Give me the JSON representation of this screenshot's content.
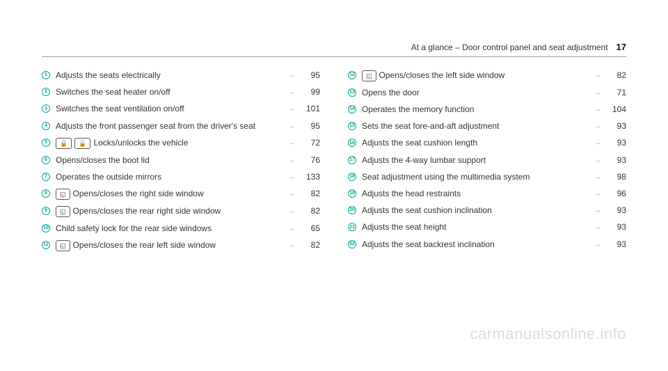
{
  "header": {
    "title": "At a glance – Door control panel and seat adjustment",
    "page": "17"
  },
  "left": [
    {
      "n": "1",
      "icons": [],
      "text": "Adjusts the seats electrically",
      "page": "95"
    },
    {
      "n": "2",
      "icons": [],
      "text": "Switches the seat heater on/off",
      "page": "99"
    },
    {
      "n": "3",
      "icons": [],
      "text": "Switches the seat ventilation on/off",
      "page": "101"
    },
    {
      "n": "4",
      "icons": [],
      "text": "Adjusts the front passenger seat from the driv­er's seat",
      "page": "95"
    },
    {
      "n": "5",
      "icons": [
        "🔒",
        "🔓"
      ],
      "text": "Locks/unlocks the vehicle",
      "page": "72"
    },
    {
      "n": "6",
      "icons": [],
      "text": "Opens/closes the boot lid",
      "page": "76"
    },
    {
      "n": "7",
      "icons": [],
      "text": "Operates the outside mirrors",
      "page": "133"
    },
    {
      "n": "8",
      "icons": [
        "◱"
      ],
      "text": "Opens/closes the right side window",
      "page": "82"
    },
    {
      "n": "9",
      "icons": [
        "◱"
      ],
      "text": "Opens/closes the rear right side window",
      "page": "82"
    },
    {
      "n": "10",
      "icons": [],
      "text": "Child safety lock for the rear side windows",
      "page": "65"
    },
    {
      "n": "11",
      "icons": [
        "◱"
      ],
      "text": "Opens/closes the rear left side window",
      "page": "82"
    }
  ],
  "right": [
    {
      "n": "12",
      "icons": [
        "◱"
      ],
      "text": "Opens/closes the left side window",
      "page": "82"
    },
    {
      "n": "13",
      "icons": [],
      "text": "Opens the door",
      "page": "71"
    },
    {
      "n": "14",
      "icons": [],
      "text": "Operates the memory function",
      "page": "104"
    },
    {
      "n": "15",
      "icons": [],
      "text": "Sets the seat fore-and-aft adjustment",
      "page": "93"
    },
    {
      "n": "16",
      "icons": [],
      "text": "Adjusts the seat cushion length",
      "page": "93"
    },
    {
      "n": "17",
      "icons": [],
      "text": "Adjusts the 4-way lumbar support",
      "page": "93"
    },
    {
      "n": "18",
      "icons": [],
      "text": "Seat adjustment using the multimedia system",
      "page": "98"
    },
    {
      "n": "19",
      "icons": [],
      "text": "Adjusts the head restraints",
      "page": "96"
    },
    {
      "n": "20",
      "icons": [],
      "text": "Adjusts the seat cushion inclination",
      "page": "93"
    },
    {
      "n": "21",
      "icons": [],
      "text": "Adjusts the seat height",
      "page": "93"
    },
    {
      "n": "22",
      "icons": [],
      "text": "Adjusts the seat backrest inclination",
      "page": "93"
    }
  ],
  "watermark": "carmanualsonline.info"
}
